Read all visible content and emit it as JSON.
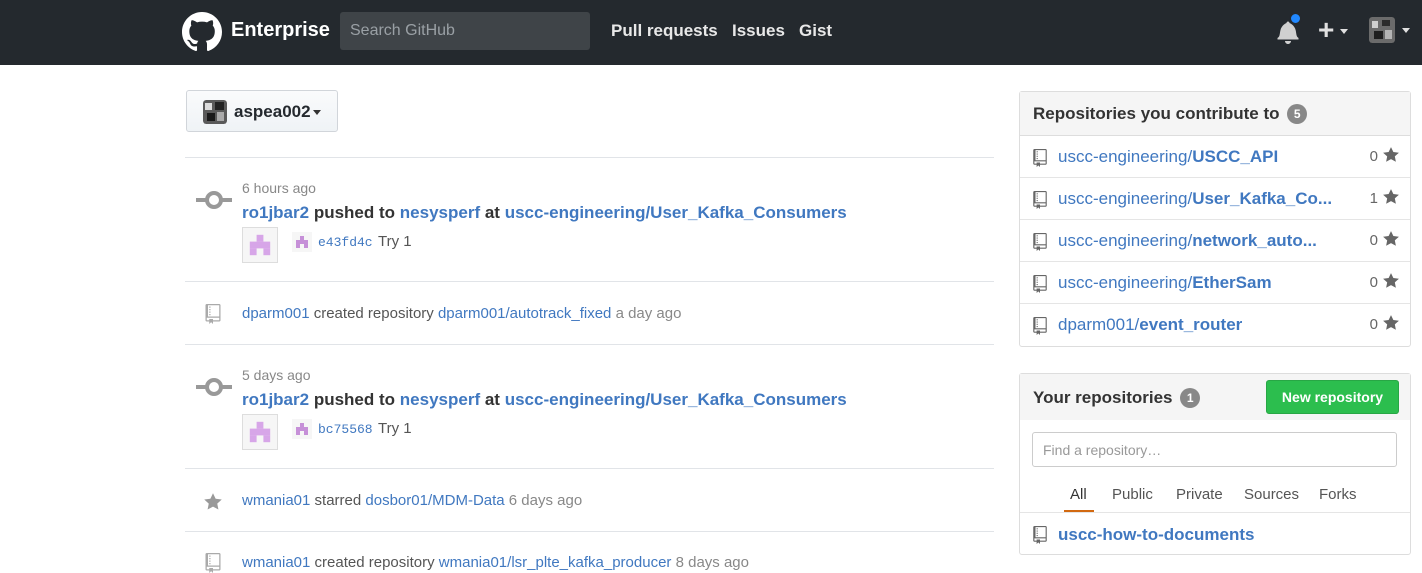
{
  "header": {
    "brand": "Enterprise",
    "search_placeholder": "Search GitHub",
    "nav": [
      "Pull requests",
      "Issues",
      "Gist"
    ],
    "plus_label": "+"
  },
  "context": {
    "user": "aspea002"
  },
  "feed": [
    {
      "type": "push",
      "time": "6 hours ago",
      "actor": "ro1jbar2",
      "verb": "pushed to",
      "branch": "nesysperf",
      "at": "at",
      "repo": "uscc-engineering/User_Kafka_Consumers",
      "commit_sha": "e43fd4c",
      "commit_msg": "Try 1"
    },
    {
      "type": "create",
      "actor": "dparm001",
      "verb": "created repository",
      "repo": "dparm001/autotrack_fixed",
      "time": "a day ago"
    },
    {
      "type": "push",
      "time": "5 days ago",
      "actor": "ro1jbar2",
      "verb": "pushed to",
      "branch": "nesysperf",
      "at": "at",
      "repo": "uscc-engineering/User_Kafka_Consumers",
      "commit_sha": "bc75568",
      "commit_msg": "Try 1"
    },
    {
      "type": "star",
      "actor": "wmania01",
      "verb": "starred",
      "repo": "dosbor01/MDM-Data",
      "time": "6 days ago"
    },
    {
      "type": "create",
      "actor": "wmania01",
      "verb": "created repository",
      "repo": "wmania01/lsr_plte_kafka_producer",
      "time": "8 days ago"
    }
  ],
  "contrib": {
    "title": "Repositories you contribute to",
    "count": "5",
    "repos": [
      {
        "owner": "uscc-engineering/",
        "name": "USCC_API",
        "stars": "0"
      },
      {
        "owner": "uscc-engineering/",
        "name": "User_Kafka_Co...",
        "stars": "1"
      },
      {
        "owner": "uscc-engineering/",
        "name": "network_auto...",
        "stars": "0"
      },
      {
        "owner": "uscc-engineering/",
        "name": "EtherSam",
        "stars": "0"
      },
      {
        "owner": "dparm001/",
        "name": "event_router",
        "stars": "0"
      }
    ]
  },
  "yours": {
    "title": "Your repositories",
    "count": "1",
    "new_button": "New repository",
    "filter_placeholder": "Find a repository…",
    "tabs": [
      "All",
      "Public",
      "Private",
      "Sources",
      "Forks"
    ],
    "repos": [
      {
        "name": "uscc-how-to-documents"
      }
    ]
  },
  "colors": {
    "header_bg": "#24292e",
    "link": "#4078c0",
    "green_button": "#2cbe4e",
    "tab_accent": "#d26911",
    "notification_dot": "#2188ff"
  }
}
